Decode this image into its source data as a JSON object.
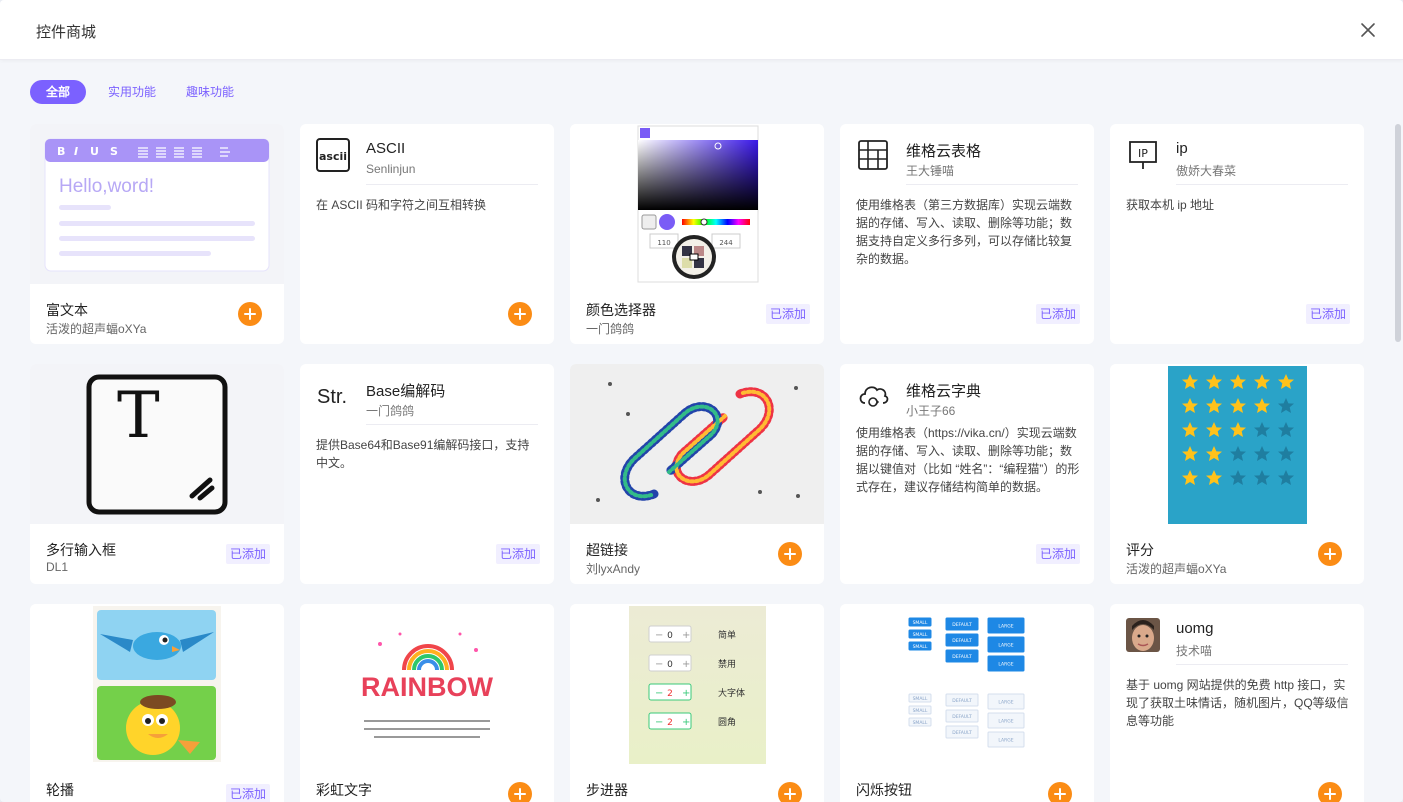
{
  "header": {
    "title": "控件商城"
  },
  "tabs": [
    {
      "label": "全部",
      "active": true
    },
    {
      "label": "实用功能",
      "active": false
    },
    {
      "label": "趣味功能",
      "active": false
    }
  ],
  "status_labels": {
    "added": "已添加"
  },
  "accent_color": "#7b61ff",
  "add_color": "#fb8c15",
  "widgets": [
    {
      "name": "富文本",
      "author": "活泼的超声蝠oXYa",
      "status": "add",
      "thumb_text": "Hello,word!"
    },
    {
      "name": "ASCII",
      "author": "Senlinjun",
      "status": "add",
      "icon": "ascii-icon",
      "icon_text": "ascii",
      "desc": "在 ASCII 码和字符之间互相转换"
    },
    {
      "name": "颜色选择器",
      "author": "一门鸽鸽",
      "status": "added",
      "picker_values": [
        "110",
        "244"
      ]
    },
    {
      "name": "维格云表格",
      "author": "王大锤喵",
      "status": "added",
      "icon": "table-icon",
      "desc": "使用维格表（第三方数据库）实现云端数据的存储、写入、读取、删除等功能；数据支持自定义多行多列，可以存储比较复杂的数据。"
    },
    {
      "name": "ip",
      "author": "傲娇大春菜",
      "status": "added",
      "icon": "ip-icon",
      "icon_text": "IP",
      "desc": "获取本机 ip 地址"
    },
    {
      "name": "多行输入框",
      "author": "DL1",
      "status": "added",
      "thumb_text": "T"
    },
    {
      "name": "Base编解码",
      "author": "一门鸽鸽",
      "status": "added",
      "icon": "str-icon",
      "icon_text": "Str.",
      "desc": "提供Base64和Base91编解码接口，支持中文。"
    },
    {
      "name": "超链接",
      "author": "刘lyxAndy",
      "status": "add"
    },
    {
      "name": "维格云字典",
      "author": "小王子66",
      "status": "added",
      "icon": "cloud-icon",
      "desc": "使用维格表（https://vika.cn/）实现云端数据的存储、写入、读取、删除等功能；数据以键值对（比如 “姓名”：“编程猫”）的形式存在，建议存储结构简单的数据。"
    },
    {
      "name": "评分",
      "author": "活泼的超声蝠oXYa",
      "status": "add"
    },
    {
      "name": "轮播",
      "author": "",
      "status": "added"
    },
    {
      "name": "彩虹文字",
      "author": "",
      "status": "add",
      "thumb_text": "RAINBOW"
    },
    {
      "name": "步进器",
      "author": "",
      "status": "add",
      "stepper_rows": [
        {
          "value": "0",
          "label": "简单"
        },
        {
          "value": "0",
          "label": "禁用"
        },
        {
          "value": "2",
          "label": "大字体"
        },
        {
          "value": "2",
          "label": "圆角"
        }
      ]
    },
    {
      "name": "闪烁按钮",
      "author": "",
      "status": "add",
      "btn_labels": [
        "SMALL",
        "DEFAULT",
        "LARGE"
      ]
    },
    {
      "name": "uomg",
      "author": "技术喵",
      "status": "add",
      "icon": "avatar",
      "desc": "基于 uomg 网站提供的免费 http 接口，实现了获取土味情话，随机图片，QQ等级信息等功能"
    }
  ]
}
